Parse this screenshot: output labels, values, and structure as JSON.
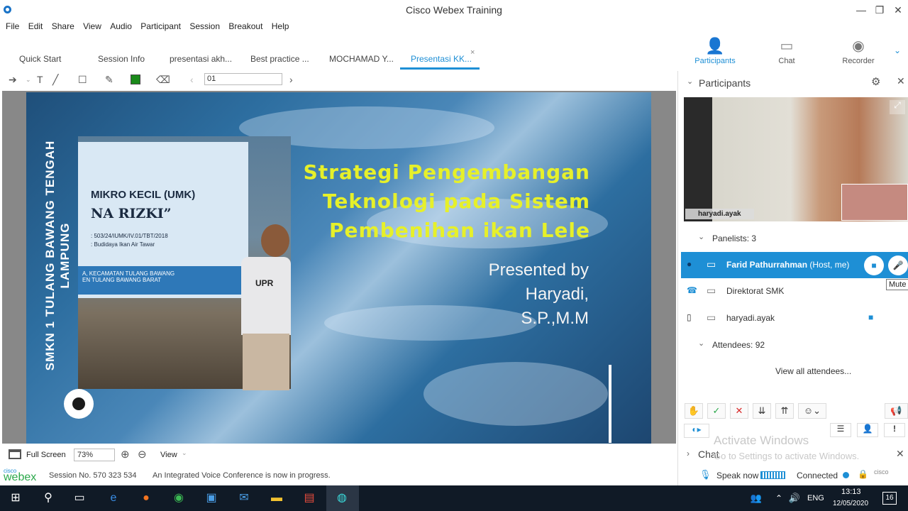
{
  "window": {
    "title": "Cisco Webex Training",
    "controls": {
      "minimize": "—",
      "restore": "❐",
      "close": "✕"
    }
  },
  "menu": [
    "File",
    "Edit",
    "Share",
    "View",
    "Audio",
    "Participant",
    "Session",
    "Breakout",
    "Help"
  ],
  "tabs": [
    {
      "label": "Quick Start"
    },
    {
      "label": "Session Info"
    },
    {
      "label": "presentasi akh..."
    },
    {
      "label": "Best practice ..."
    },
    {
      "label": "MOCHAMAD Y..."
    },
    {
      "label": "Presentasi KK...",
      "active": true
    }
  ],
  "toolbar": {
    "slide_number": "01"
  },
  "slide": {
    "vertical_text": [
      "SMKN 1 TULANG BAWANG TENGAH",
      "LAMPUNG"
    ],
    "title_lines": [
      "Strategi Pengembangan",
      "Teknologi pada Sistem",
      "Pembenihan ikan Lele"
    ],
    "presenter_lines": [
      "Presented by",
      "Haryadi,",
      "S.P.,M.M"
    ],
    "banner": {
      "line1": "MIKRO KECIL (UMK)",
      "line2": "NA RIZKI”",
      "line3": ": 503/24/IUMK/IV.01/TBT/2018",
      "line4": ": Budidaya Ikan Air Tawar",
      "line5": "A, KECAMATAN TULANG BAWANG",
      "line6": "EN TULANG BAWANG BARAT"
    },
    "shirt_text": "UPR"
  },
  "bottom_toolbar": {
    "full_screen": "Full Screen",
    "zoom": "73%",
    "view": "View"
  },
  "status": {
    "brand_small": "cisco",
    "brand": "webex",
    "session": "Session No. 570 323 534",
    "message": "An Integrated Voice Conference is now in progress."
  },
  "right_toolbar": {
    "participants": "Participants",
    "chat": "Chat",
    "recorder": "Recorder"
  },
  "participants_panel": {
    "title": "Participants",
    "video_name": "haryadi.ayak",
    "panelists_label": "Panelists: 3",
    "panelists": [
      {
        "name": "Farid Pathurrahman",
        "role": "(Host, me)",
        "selected": true
      },
      {
        "name": "Direktorat SMK"
      },
      {
        "name": "haryadi.ayak"
      }
    ],
    "mute_tooltip": "Mute",
    "attendees_label": "Attendees: 92",
    "view_all": "View all attendees..."
  },
  "chat_panel": {
    "label": "Chat"
  },
  "audio_status": {
    "speak_now": "Speak now",
    "connected": "Connected"
  },
  "watermark": {
    "line1": "Activate Windows",
    "line2": "Go to Settings to activate Windows."
  },
  "taskbar": {
    "language": "ENG",
    "time": "13:13",
    "date": "12/05/2020",
    "notifications": "16"
  },
  "colors": {
    "accent": "#1e8fd5",
    "slide_title": "#e6f02a",
    "taskbar": "#101a26"
  }
}
